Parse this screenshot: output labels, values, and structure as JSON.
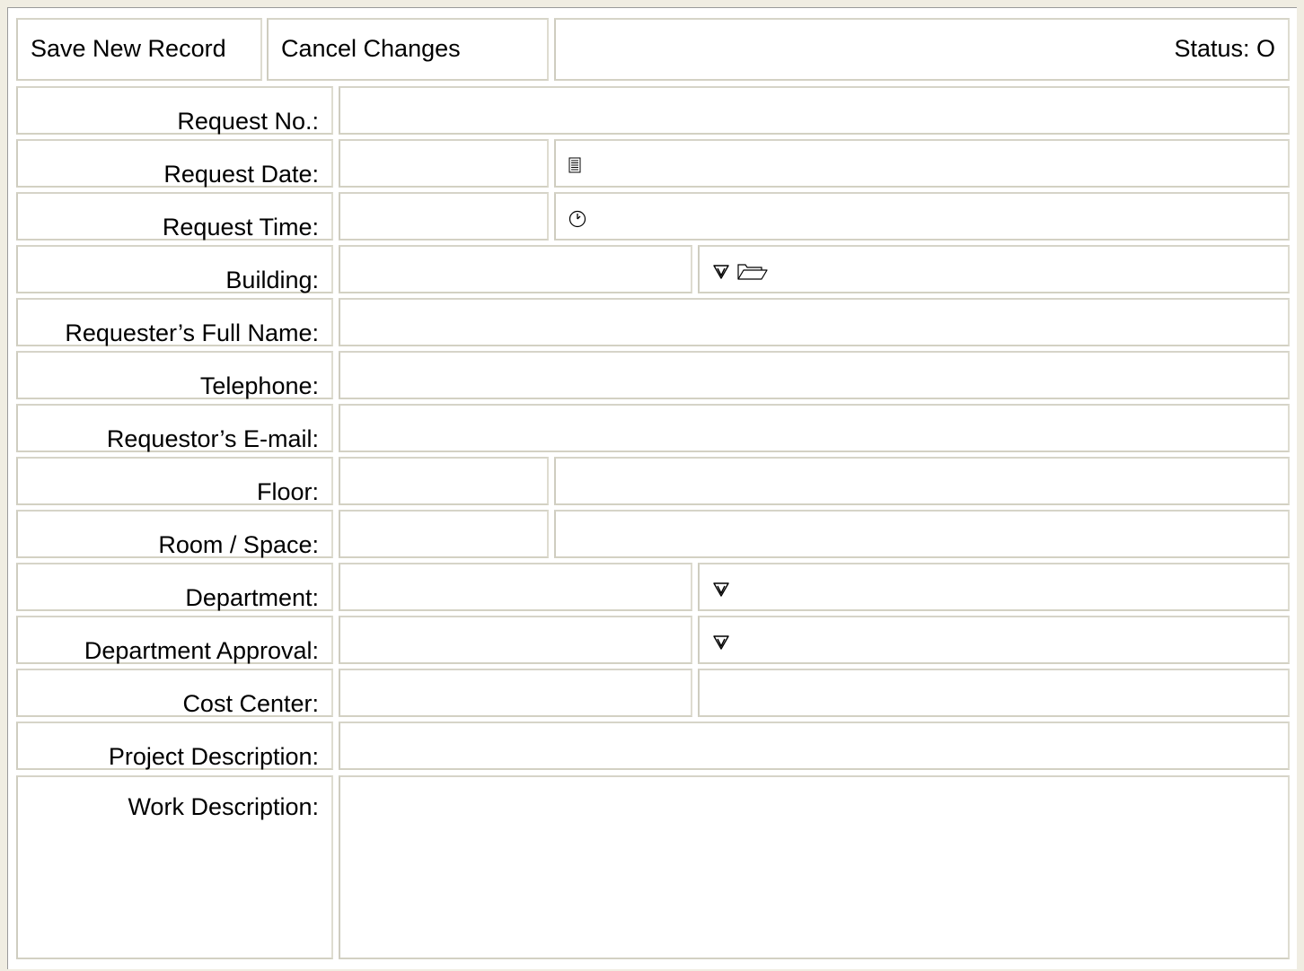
{
  "toolbar": {
    "save_label": "Save New Record",
    "cancel_label": "Cancel Changes",
    "status_text": "Status: O"
  },
  "form": {
    "request_no_label": "Request No.:",
    "request_date_label": "Request Date:",
    "request_time_label": "Request Time:",
    "building_label": "Building:",
    "requester_name_label": "Requester’s Full Name:",
    "telephone_label": "Telephone:",
    "email_label": "Requestor’s E-mail:",
    "floor_label": "Floor:",
    "room_label": "Room / Space:",
    "department_label": "Department:",
    "department_approval_label": "Department Approval:",
    "cost_center_label": "Cost Center:",
    "project_description_label": "Project Description:",
    "work_description_label": "Work Description:"
  },
  "icons": {
    "calendar": "calendar-icon",
    "clock": "clock-icon",
    "select_arrow": "select-arrow-icon",
    "folder": "folder-icon"
  }
}
